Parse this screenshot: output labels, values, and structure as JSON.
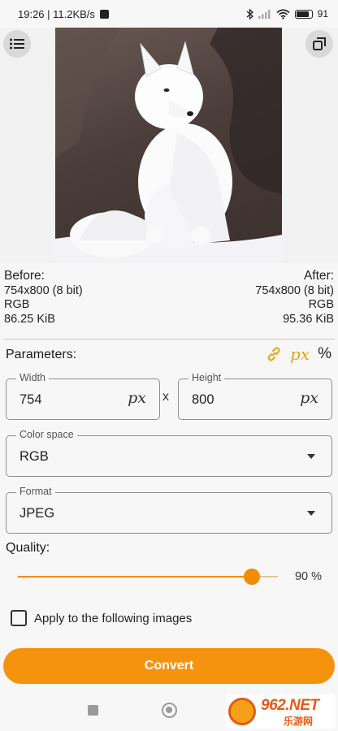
{
  "status_bar": {
    "time_speed": "19:26 | 11.2KB/s",
    "battery_percent": "91"
  },
  "before": {
    "heading": "Before:",
    "dimensions": "754x800 (8 bit)",
    "color_space": "RGB",
    "file_size": "86.25 KiB"
  },
  "after": {
    "heading": "After:",
    "dimensions": "754x800 (8 bit)",
    "color_space": "RGB",
    "file_size": "95.36 KiB"
  },
  "parameters": {
    "label": "Parameters:",
    "unit_px": "px",
    "unit_percent": "%"
  },
  "width_field": {
    "label": "Width",
    "value": "754",
    "unit": "px"
  },
  "height_field": {
    "label": "Height",
    "value": "800",
    "unit": "px"
  },
  "size_separator": "x",
  "color_space_field": {
    "label": "Color space",
    "value": "RGB"
  },
  "format_field": {
    "label": "Format",
    "value": "JPEG"
  },
  "quality": {
    "label": "Quality:",
    "value_text": "90 %",
    "level_fraction": 0.9
  },
  "apply_option": {
    "label": "Apply to the following images",
    "checked": false
  },
  "convert_button": {
    "label": "Convert"
  },
  "watermark": {
    "number": "962.NET",
    "subtitle": "乐游网"
  },
  "colors": {
    "accent": "#f6930e",
    "link_icon": "#e3a316",
    "background": "#f7f7f7"
  },
  "icons": [
    "menu-icon",
    "crop-icon",
    "link-icon",
    "dropdown-arrow-icon",
    "nav-recents-icon",
    "nav-home-icon"
  ]
}
